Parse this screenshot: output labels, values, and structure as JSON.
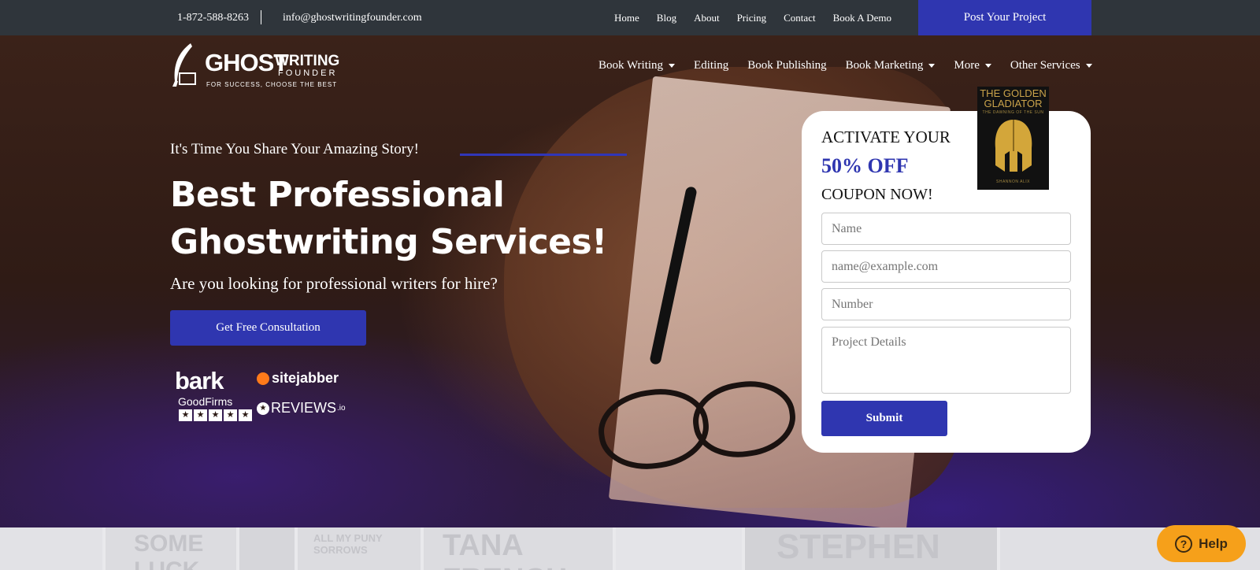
{
  "topbar": {
    "phone": "1-872-588-8263",
    "email": "info@ghostwritingfounder.com",
    "links": [
      "Home",
      "Blog",
      "About",
      "Pricing",
      "Contact",
      "Book A Demo"
    ],
    "post_button": "Post Your Project"
  },
  "logo": {
    "word1": "GHOST",
    "word2": "WRITING",
    "word3": "FOUNDER",
    "tagline": "FOR SUCCESS, CHOOSE THE BEST"
  },
  "nav": {
    "items": [
      {
        "label": "Book Writing",
        "dropdown": true
      },
      {
        "label": "Editing",
        "dropdown": false
      },
      {
        "label": "Book Publishing",
        "dropdown": false
      },
      {
        "label": "Book Marketing",
        "dropdown": true
      },
      {
        "label": "More",
        "dropdown": true
      },
      {
        "label": "Other Services",
        "dropdown": true
      }
    ]
  },
  "hero": {
    "eyebrow": "It's Time You Share Your Amazing Story!",
    "headline": "Best Professional Ghostwriting Services!",
    "subline": "Are you looking for professional writers for hire?",
    "cta": "Get Free Consultation"
  },
  "reviews": {
    "bark": "bark",
    "sitejabber": "sitejabber",
    "goodfirms": "GoodFirms",
    "goodfirms_stars": 5,
    "reviews_io": "REVIEWS",
    "reviews_io_suffix": ".io"
  },
  "form": {
    "line1": "ACTIVATE YOUR",
    "line2": "50% OFF",
    "line3": "COUPON NOW!",
    "name_placeholder": "Name",
    "email_placeholder": "name@example.com",
    "number_placeholder": "Number",
    "details_placeholder": "Project Details",
    "submit": "Submit"
  },
  "book": {
    "title": "THE GOLDEN GLADIATOR",
    "subtitle": "THE DAWNING OF THE SUN",
    "author": "SHANNON ALIX"
  },
  "strip": {
    "covers": [
      "SOME LUCK",
      "ALL MY PUNY SORROWS",
      "TANA FRENCH",
      "STEPHEN"
    ]
  },
  "help": {
    "label": "Help"
  },
  "colors": {
    "accent": "#2f36b0",
    "topbar": "#2f353b",
    "help": "#f6a01a"
  }
}
